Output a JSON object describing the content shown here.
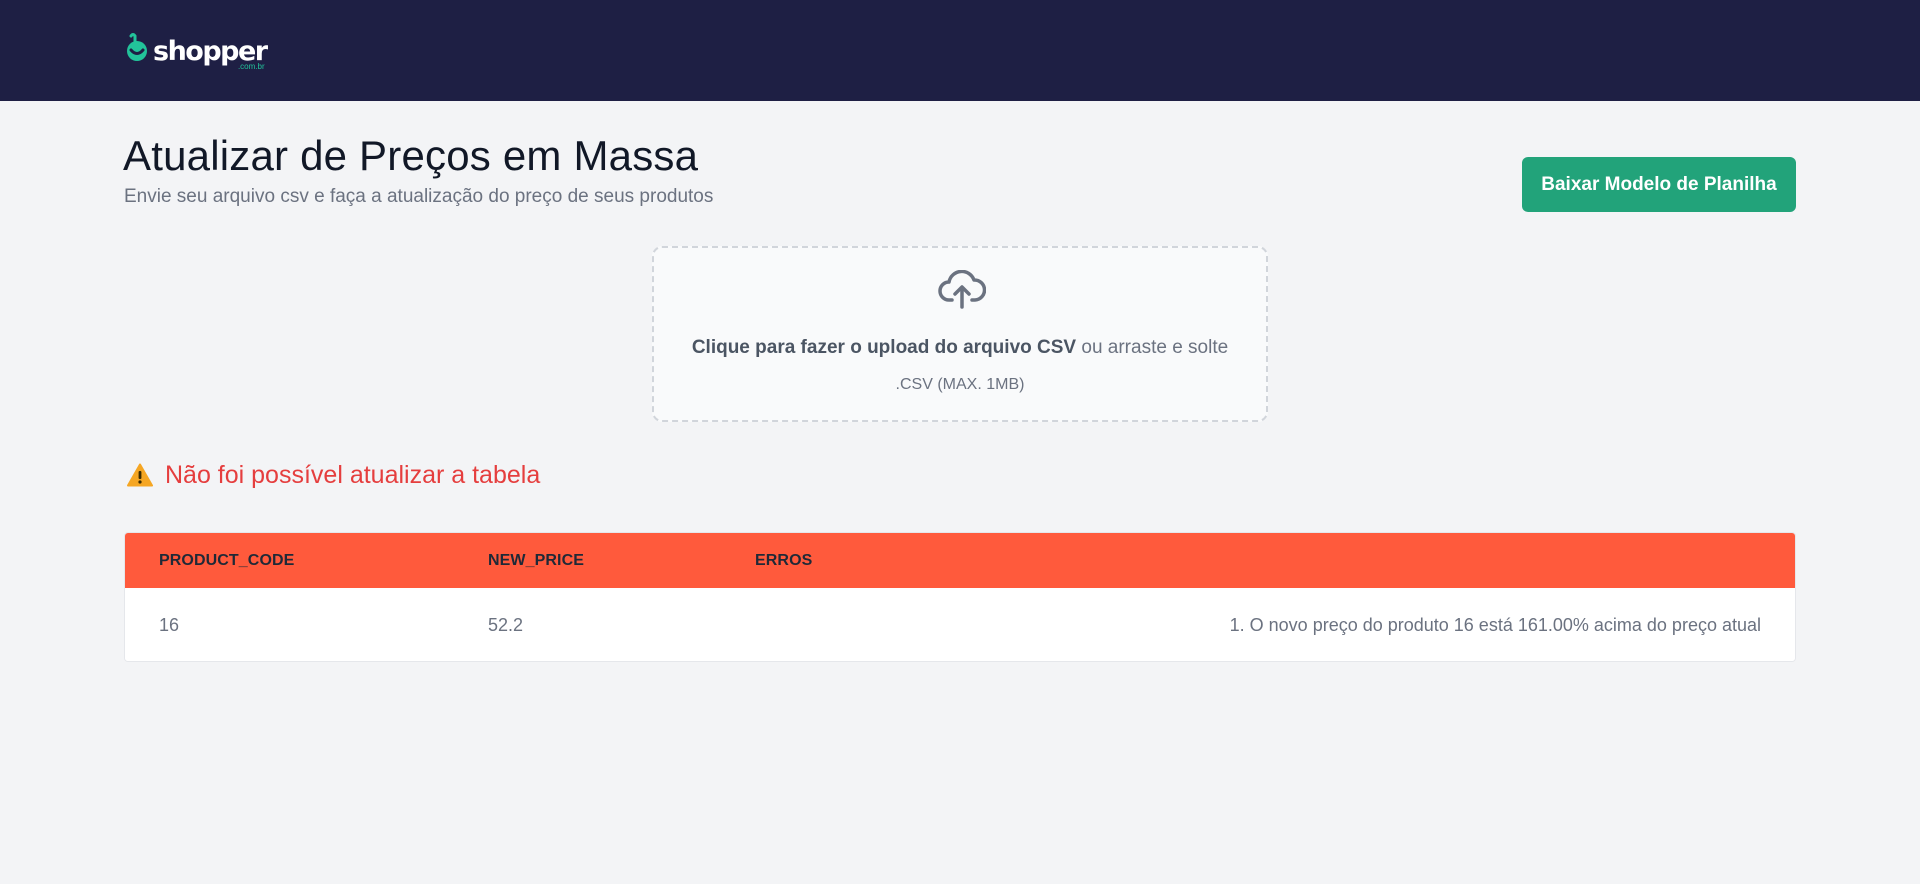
{
  "brand": {
    "name": "shopper",
    "suffix": ".com.br"
  },
  "header": {
    "title": "Atualizar de Preços em Massa",
    "subtitle": "Envie seu arquivo csv e faça a atualização do preço de seus produtos",
    "download_button": "Baixar Modelo de Planilha"
  },
  "upload": {
    "icon": "cloud-upload-icon",
    "action_text": "Clique para fazer o upload do arquivo CSV",
    "drag_text": " ou arraste e solte",
    "hint": ".CSV (MAX. 1MB)"
  },
  "error": {
    "icon": "warning-icon",
    "message": "Não foi possível atualizar a tabela"
  },
  "table": {
    "columns": [
      "PRODUCT_CODE",
      "NEW_PRICE",
      "ERROS"
    ],
    "rows": [
      {
        "product_code": "16",
        "new_price": "52.2",
        "errors": "1. O novo preço do produto 16 está 161.00% acima do preço atual"
      }
    ]
  },
  "colors": {
    "topbar": "#1e1f44",
    "brand_green": "#22c39a",
    "button": "#22a37a",
    "table_header": "#ff5a3c",
    "error": "#e53e3e"
  }
}
